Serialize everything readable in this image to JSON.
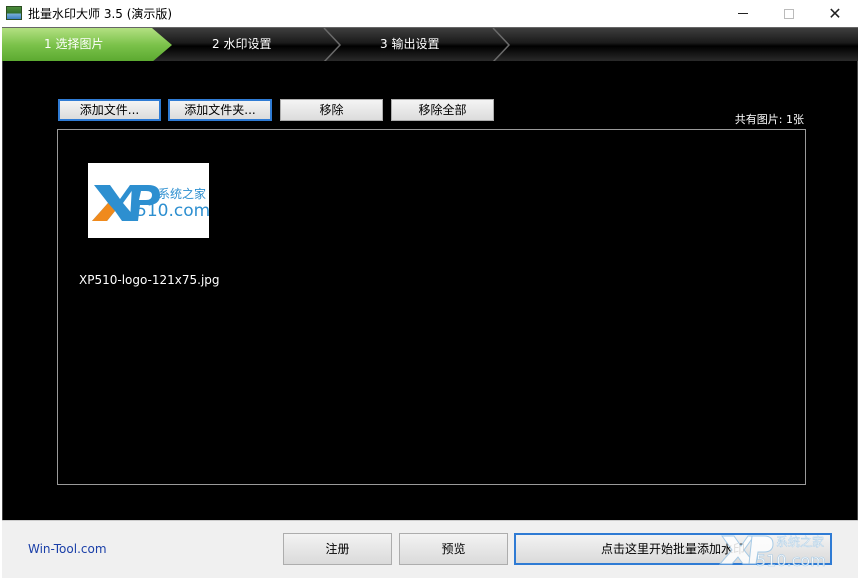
{
  "window": {
    "title": "批量水印大师 3.5 (演示版)",
    "minimize": "—",
    "close": "✕"
  },
  "steps": [
    {
      "label": "1 选择图片",
      "active": true
    },
    {
      "label": "2 水印设置",
      "active": false
    },
    {
      "label": "3 输出设置",
      "active": false
    }
  ],
  "toolbar": {
    "add_file": "添加文件...",
    "add_folder": "添加文件夹...",
    "remove": "移除",
    "remove_all": "移除全部"
  },
  "status": {
    "image_count": "共有图片: 1张"
  },
  "files": [
    {
      "name": "XP510-logo-121x75.jpg",
      "thumb_logo": {
        "cn": "系统之家",
        "brand": "510.com",
        "letters": "XP"
      }
    }
  ],
  "footer": {
    "link": "Win-Tool.com",
    "register": "注册",
    "preview": "预览",
    "start": "点击这里开始批量添加水印"
  },
  "watermark": {
    "cn": "系统之家",
    "brand": "510.com"
  },
  "colors": {
    "accent_green": "#7bc24a",
    "focus_blue": "#2f7bd4",
    "logo_blue": "#2d8fd0",
    "logo_orange": "#f08a1c",
    "link_blue": "#1a3fa8"
  }
}
